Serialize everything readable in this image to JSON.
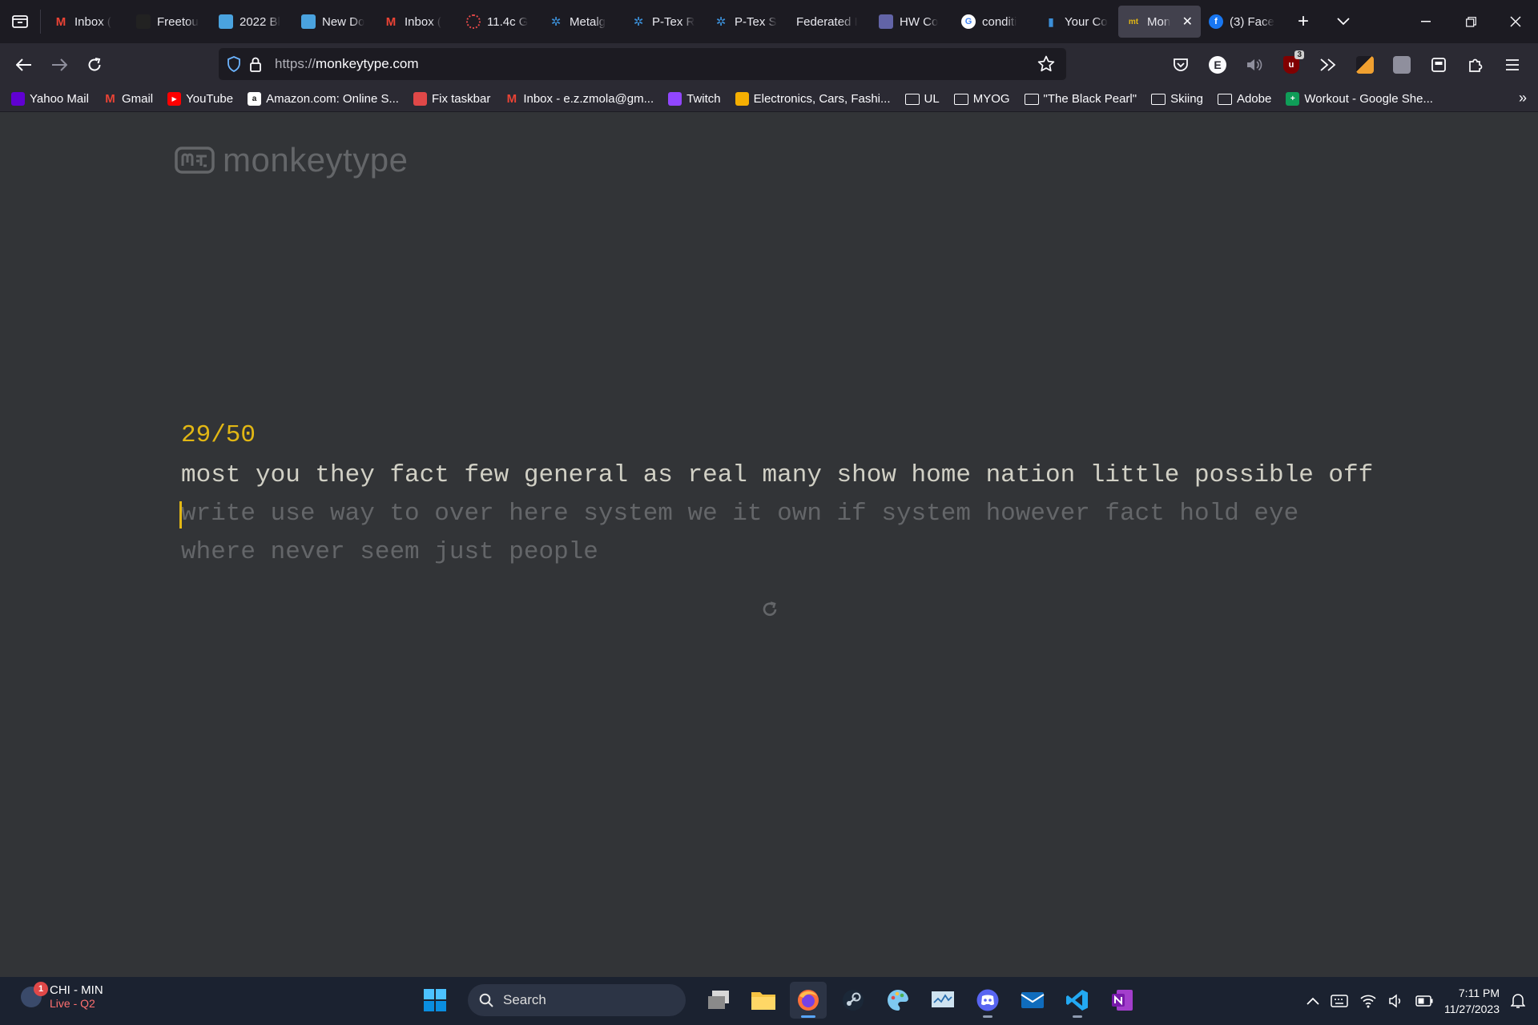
{
  "browser": {
    "tabs": [
      {
        "title": "Inbox (",
        "favicon": "gmail-icon",
        "color": "#ea4335"
      },
      {
        "title": "Freetou",
        "favicon": "freetour-icon",
        "color": "#222222"
      },
      {
        "title": "2022 Bl",
        "favicon": "doc-icon",
        "color": "#4aa3df"
      },
      {
        "title": "New Do",
        "favicon": "doc-icon",
        "color": "#4aa3df"
      },
      {
        "title": "Inbox (",
        "favicon": "gmail-icon",
        "color": "#ea4335"
      },
      {
        "title": "11.4c G",
        "favicon": "loading-icon",
        "color": "#e04848"
      },
      {
        "title": "Metalg",
        "favicon": "gear-icon",
        "color": "#3b8fd8"
      },
      {
        "title": "P-Tex R",
        "favicon": "gear-icon",
        "color": "#3b8fd8"
      },
      {
        "title": "P-Tex S",
        "favicon": "gear-icon",
        "color": "#3b8fd8"
      },
      {
        "title": "Federated I",
        "favicon": "",
        "color": ""
      },
      {
        "title": "HW Co",
        "favicon": "teams-icon",
        "color": "#6264a7"
      },
      {
        "title": "conditi",
        "favicon": "google-icon",
        "color": "#ffffff"
      },
      {
        "title": "Your Co",
        "favicon": "chart-icon",
        "color": "#3b8fd8"
      },
      {
        "title": "Mon",
        "favicon": "monkeytype-icon",
        "color": "#e2b714",
        "active": true
      },
      {
        "title": "(3) Face",
        "favicon": "facebook-icon",
        "color": "#1877f2"
      }
    ],
    "url_protocol": "https://",
    "url_host": "monkeytype.com",
    "extension_badge": "3",
    "bookmarks": [
      {
        "label": "Yahoo Mail",
        "icon": "yahoo-icon",
        "color": "#6001d2"
      },
      {
        "label": "Gmail",
        "icon": "gmail-icon",
        "color": "#ea4335"
      },
      {
        "label": "YouTube",
        "icon": "youtube-icon",
        "color": "#ff0000"
      },
      {
        "label": "Amazon.com: Online S...",
        "icon": "amazon-icon",
        "color": "#ffffff"
      },
      {
        "label": "Fix taskbar",
        "icon": "hd-icon",
        "color": "#e04848"
      },
      {
        "label": "Inbox - e.z.zmola@gm...",
        "icon": "gmail-icon",
        "color": "#ea4335"
      },
      {
        "label": "Twitch",
        "icon": "twitch-icon",
        "color": "#9146ff"
      },
      {
        "label": "Electronics, Cars, Fashi...",
        "icon": "ebay-icon",
        "color": "#f5af02"
      },
      {
        "label": "UL",
        "icon": "folder-icon",
        "color": ""
      },
      {
        "label": "MYOG",
        "icon": "folder-icon",
        "color": ""
      },
      {
        "label": "\"The Black Pearl\"",
        "icon": "folder-icon",
        "color": ""
      },
      {
        "label": "Skiing",
        "icon": "folder-icon",
        "color": ""
      },
      {
        "label": "Adobe",
        "icon": "folder-icon",
        "color": ""
      },
      {
        "label": "Workout - Google She...",
        "icon": "sheets-icon",
        "color": "#0f9d58"
      }
    ]
  },
  "monkeytype": {
    "logo_text": "monkeytype",
    "progress": "29/50",
    "typed_words": "most you they fact few general as real many show home nation little possible off",
    "untyped_words": "write use way to over here system we it own if system however fact hold eye where never seem just people",
    "accent_color": "#e2b714",
    "text_color": "#d1d0c5",
    "sub_color": "#646669",
    "bg_color": "#323437"
  },
  "taskbar": {
    "widget_line1": "CHI - MIN",
    "widget_line2": "Live - Q2",
    "widget_badge": "1",
    "search_label": "Search",
    "time": "7:11 PM",
    "date": "11/27/2023"
  }
}
